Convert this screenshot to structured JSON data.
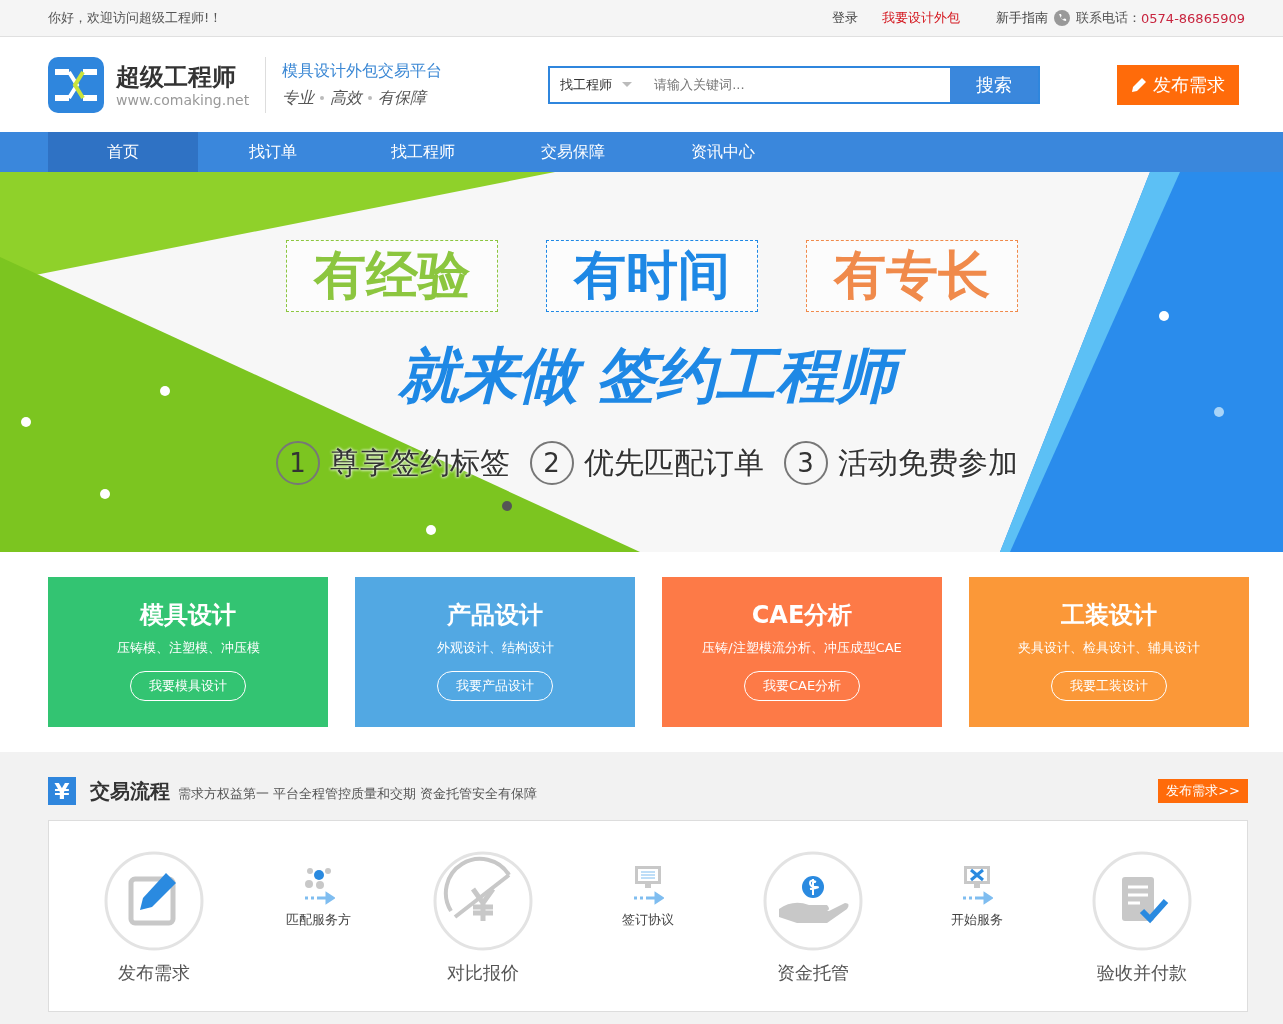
{
  "top_bar": {
    "greeting": "你好，欢迎访问超级工程师!！",
    "links": [
      {
        "label": "登录",
        "kind": "plain"
      },
      {
        "label": "我要设计外包",
        "kind": "highlight"
      },
      {
        "label": "新手指南",
        "kind": "plain"
      }
    ],
    "phone_label": "联系电话：",
    "phone": "0574-86865909"
  },
  "header": {
    "logo_name": "超级工程师",
    "logo_url": "www.comaking.net",
    "slogan": "模具设计外包交易平台",
    "motto": [
      "专业",
      "高效",
      "有保障"
    ],
    "search": {
      "category": "找工程师",
      "placeholder": "请输入关键词...",
      "button": "搜索"
    },
    "post_button": "发布需求"
  },
  "nav": [
    {
      "label": "首页",
      "selected": true
    },
    {
      "label": "找订单",
      "selected": false
    },
    {
      "label": "找工程师",
      "selected": false
    },
    {
      "label": "交易保障",
      "selected": false
    },
    {
      "label": "资讯中心",
      "selected": false
    }
  ],
  "banner": {
    "tags": [
      {
        "text": "有经验",
        "color": "#8cc63f"
      },
      {
        "text": "有时间",
        "color": "#1e88e5"
      },
      {
        "text": "有专长",
        "color": "#f08a4b"
      }
    ],
    "headline_a": "就来做",
    "headline_b": "签约工程师",
    "benefits": [
      {
        "number": "1",
        "text": "尊享签约标签"
      },
      {
        "number": "2",
        "text": "优先匹配订单"
      },
      {
        "number": "3",
        "text": "活动免费参加"
      }
    ],
    "dots": [
      {
        "selected": true
      }
    ]
  },
  "services": [
    {
      "title": "模具设计",
      "subtitle": "压铸模、注塑模、冲压模",
      "button": "我要模具设计",
      "color": "#33c472"
    },
    {
      "title": "产品设计",
      "subtitle": "外观设计、结构设计",
      "button": "我要产品设计",
      "color": "#52a8e3"
    },
    {
      "title": "CAE分析",
      "subtitle": "压铸/注塑模流分析、冲压成型CAE",
      "button": "我要CAE分析",
      "color": "#fd7a47"
    },
    {
      "title": "工装设计",
      "subtitle": "夹具设计、检具设计、辅具设计",
      "button": "我要工装设计",
      "color": "#fb9838"
    }
  ],
  "process": {
    "icon_char": "¥",
    "title": "交易流程",
    "subtitle": "需求方权益第一 平台全程管控质量和交期 资金托管安全有保障",
    "button": "发布需求>>",
    "steps": [
      {
        "kind": "major",
        "label": "发布需求"
      },
      {
        "kind": "minor",
        "label": "匹配服务方"
      },
      {
        "kind": "major",
        "label": "对比报价"
      },
      {
        "kind": "minor",
        "label": "签订协议"
      },
      {
        "kind": "major",
        "label": "资金托管"
      },
      {
        "kind": "minor",
        "label": "开始服务"
      },
      {
        "kind": "major",
        "label": "验收并付款"
      }
    ]
  }
}
